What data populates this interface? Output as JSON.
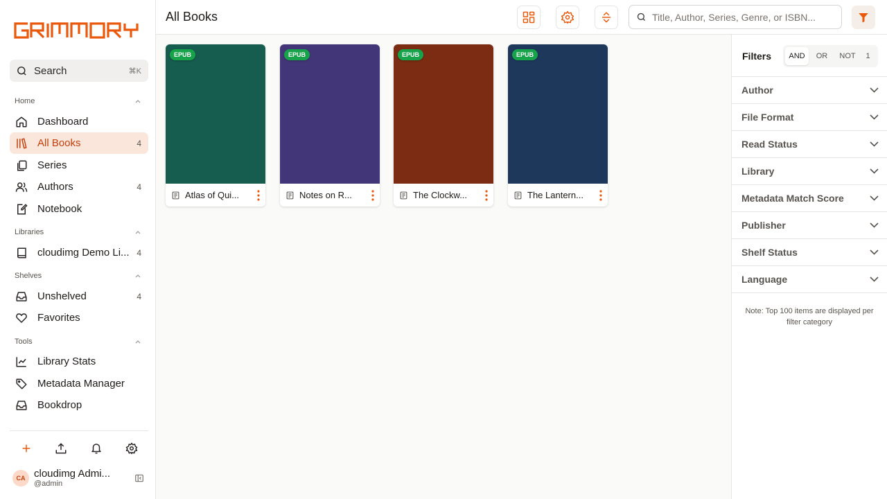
{
  "app": {
    "logo_text": "GRIMMORY"
  },
  "sidebar": {
    "search": {
      "label": "Search",
      "shortcut": "⌘K"
    },
    "sections": {
      "home": "Home",
      "libraries": "Libraries",
      "shelves": "Shelves",
      "tools": "Tools"
    },
    "items": [
      {
        "label": "Dashboard",
        "icon": "home-icon",
        "count": ""
      },
      {
        "label": "All Books",
        "icon": "books-icon",
        "count": "4",
        "active": true
      },
      {
        "label": "Series",
        "icon": "series-icon",
        "count": ""
      },
      {
        "label": "Authors",
        "icon": "users-icon",
        "count": "4"
      },
      {
        "label": "Notebook",
        "icon": "notebook-icon",
        "count": ""
      },
      {
        "label": "cloudimg Demo Li...",
        "icon": "book-icon",
        "count": "4"
      },
      {
        "label": "Unshelved",
        "icon": "inbox-icon",
        "count": "4"
      },
      {
        "label": "Favorites",
        "icon": "heart-icon",
        "count": ""
      },
      {
        "label": "Library Stats",
        "icon": "chart-line-icon",
        "count": ""
      },
      {
        "label": "Metadata Manager",
        "icon": "tag-icon",
        "count": ""
      },
      {
        "label": "Bookdrop",
        "icon": "inbox-icon",
        "count": ""
      }
    ],
    "user": {
      "initials": "CA",
      "name": "cloudimg Admi...",
      "handle": "@admin"
    }
  },
  "header": {
    "title": "All Books",
    "search_placeholder": "Title, Author, Series, Genre, or ISBN..."
  },
  "books": [
    {
      "title": "Atlas of Qui...",
      "format": "EPUB",
      "color": "#165c4f"
    },
    {
      "title": "Notes on R...",
      "format": "EPUB",
      "color": "#433678"
    },
    {
      "title": "The Clockw...",
      "format": "EPUB",
      "color": "#7b2c12"
    },
    {
      "title": "The Lantern...",
      "format": "EPUB",
      "color": "#1e385c"
    }
  ],
  "filters": {
    "title": "Filters",
    "modes": [
      "AND",
      "OR",
      "NOT",
      "1"
    ],
    "categories": [
      "Author",
      "File Format",
      "Read Status",
      "Library",
      "Metadata Match Score",
      "Publisher",
      "Shelf Status",
      "Language"
    ],
    "note": "Note: Top 100 items are displayed per filter category"
  },
  "colors": {
    "accent": "#ea580c",
    "active_bg": "#fbe6dc",
    "badge": "#16a34a"
  }
}
